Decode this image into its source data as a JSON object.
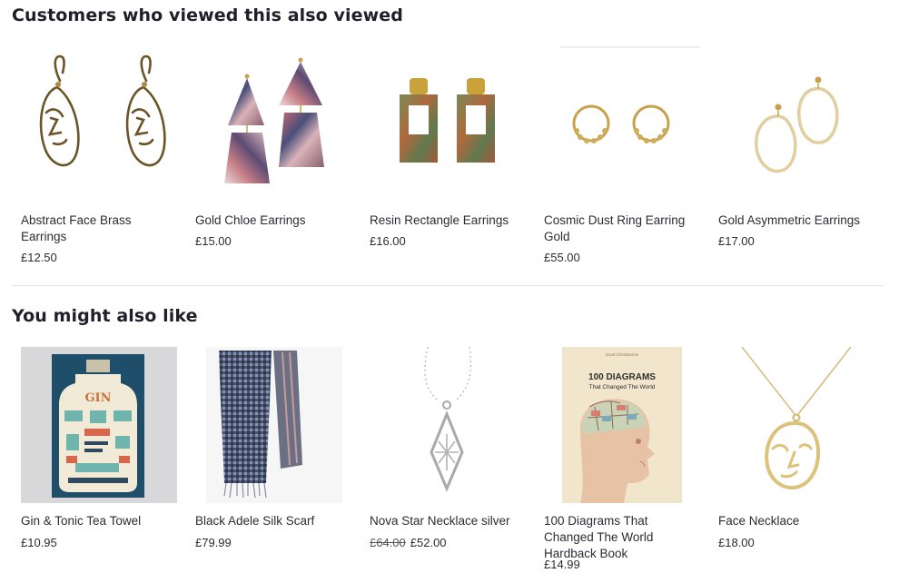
{
  "sections": {
    "viewed": {
      "title": "Customers who viewed this also viewed",
      "items": [
        {
          "name": "Abstract Face Brass Earrings",
          "price": "£12.50"
        },
        {
          "name": "Gold Chloe Earrings",
          "price": "£15.00"
        },
        {
          "name": "Resin Rectangle Earrings",
          "price": "£16.00"
        },
        {
          "name": "Cosmic Dust Ring Earring Gold",
          "price": "£55.00"
        },
        {
          "name": "Gold Asymmetric Earrings",
          "price": "£17.00"
        }
      ]
    },
    "like": {
      "title": "You might also like",
      "items": [
        {
          "name": "Gin & Tonic Tea Towel",
          "price": "£10.95"
        },
        {
          "name": "Black Adele Silk Scarf",
          "price": "£79.99"
        },
        {
          "name": "Nova Star Necklace silver",
          "old_price": "£64.00",
          "price": "£52.00"
        },
        {
          "name": "100 Diagrams That Changed The World Hardback Book",
          "price": "£14.99"
        },
        {
          "name": "Face Necklace",
          "price": "£18.00"
        }
      ]
    }
  },
  "images": {
    "gin_label": "GIN",
    "book_author": "Scott Christianson",
    "book_title_1": "100 DIAGRAMS",
    "book_title_2": "That Changed The World"
  },
  "colors": {
    "heading": "#20202a",
    "text": "#2b2b33",
    "gold": "#c8a24a",
    "brass": "#6b5527",
    "divider": "#e3e3e3"
  }
}
